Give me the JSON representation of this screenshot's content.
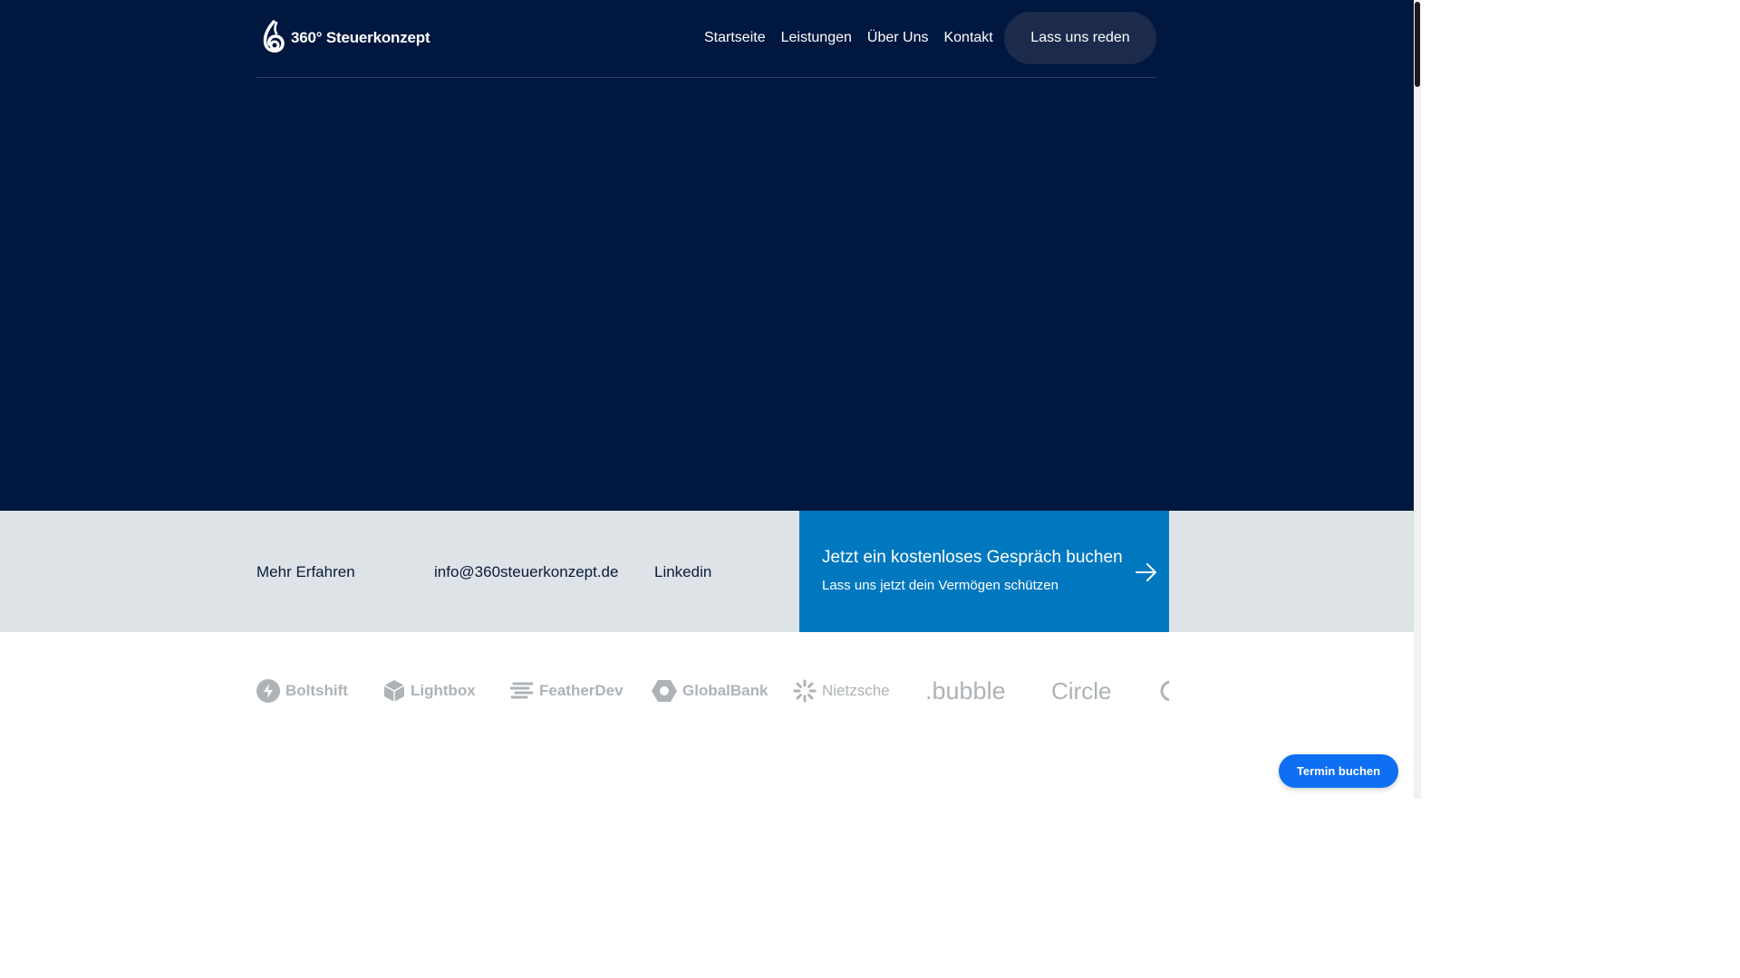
{
  "header": {
    "logo_text": "360° Steuerkonzept",
    "nav": [
      "Startseite",
      "Leistungen",
      "Über Uns",
      "Kontakt"
    ],
    "cta_label": "Lass uns reden"
  },
  "band": {
    "learn_more": "Mehr Erfahren",
    "email": "info@360steuerkonzept.de",
    "linkedin": "Linkedin",
    "promo_title": "Jetzt ein kostenloses Gespräch buchen",
    "promo_subtitle": "Lass uns jetzt dein Vermögen schützen"
  },
  "brands": [
    "Boltshift",
    "Lightbox",
    "FeatherDev",
    "GlobalBank",
    "Nietzsche",
    ".bubble",
    "Circle"
  ],
  "floating_button": "Termin buchen",
  "colors": {
    "hero_bg": "#00173f",
    "band_bg": "#dde3e6",
    "promo_bg": "#0078bf",
    "cta_blue": "#0e6ff2",
    "brand_grey": "#aeb3b7"
  }
}
